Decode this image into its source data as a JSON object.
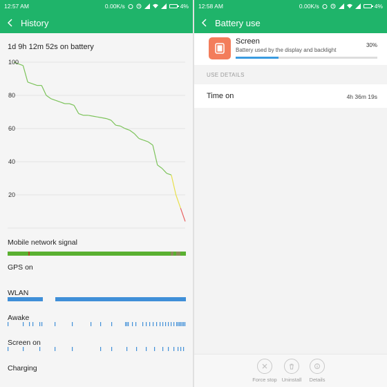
{
  "left": {
    "status": {
      "time": "12:57 AM",
      "speed": "0.00K/s",
      "battery": "4%"
    },
    "title": "History",
    "summary": "1d 9h 12m 52s on battery",
    "chart_data": {
      "type": "line",
      "ylim": [
        0,
        100
      ],
      "yticks": [
        "100",
        "80",
        "60",
        "40",
        "20"
      ],
      "series": [
        {
          "values": [
            100,
            99,
            98,
            88,
            87,
            86,
            86,
            80,
            78,
            77,
            76,
            75,
            75,
            74,
            69,
            68,
            68,
            67.5,
            67,
            66.5,
            66,
            65,
            62,
            61.5,
            60,
            59,
            57,
            54,
            53,
            52,
            50,
            38,
            36,
            33,
            32,
            20,
            12,
            4
          ],
          "colors": {
            "high": "#7cc35a",
            "mid": "#e8e04a",
            "low": "#e86060"
          }
        }
      ]
    },
    "tracks": [
      {
        "label": "Mobile network signal"
      },
      {
        "label": "GPS on"
      },
      {
        "label": "WLAN"
      },
      {
        "label": "Awake"
      },
      {
        "label": "Screen on"
      },
      {
        "label": "Charging"
      }
    ]
  },
  "right": {
    "status": {
      "time": "12:58 AM",
      "speed": "0.00K/s",
      "battery": "4%"
    },
    "title": "Battery use",
    "app": {
      "name": "Screen",
      "description": "Battery used by the display and backlight",
      "percent": "30%",
      "fraction": 0.3
    },
    "section": "USE DETAILS",
    "detail": {
      "label": "Time on",
      "value": "4h 36m 19s"
    },
    "actions": [
      {
        "label": "Force stop",
        "icon": "close-icon"
      },
      {
        "label": "Uninstall",
        "icon": "trash-icon"
      },
      {
        "label": "Details",
        "icon": "info-icon"
      }
    ]
  },
  "colors": {
    "accent": "#1fb46a",
    "signal": "#5ab031",
    "wlan": "#3f8fd8"
  }
}
